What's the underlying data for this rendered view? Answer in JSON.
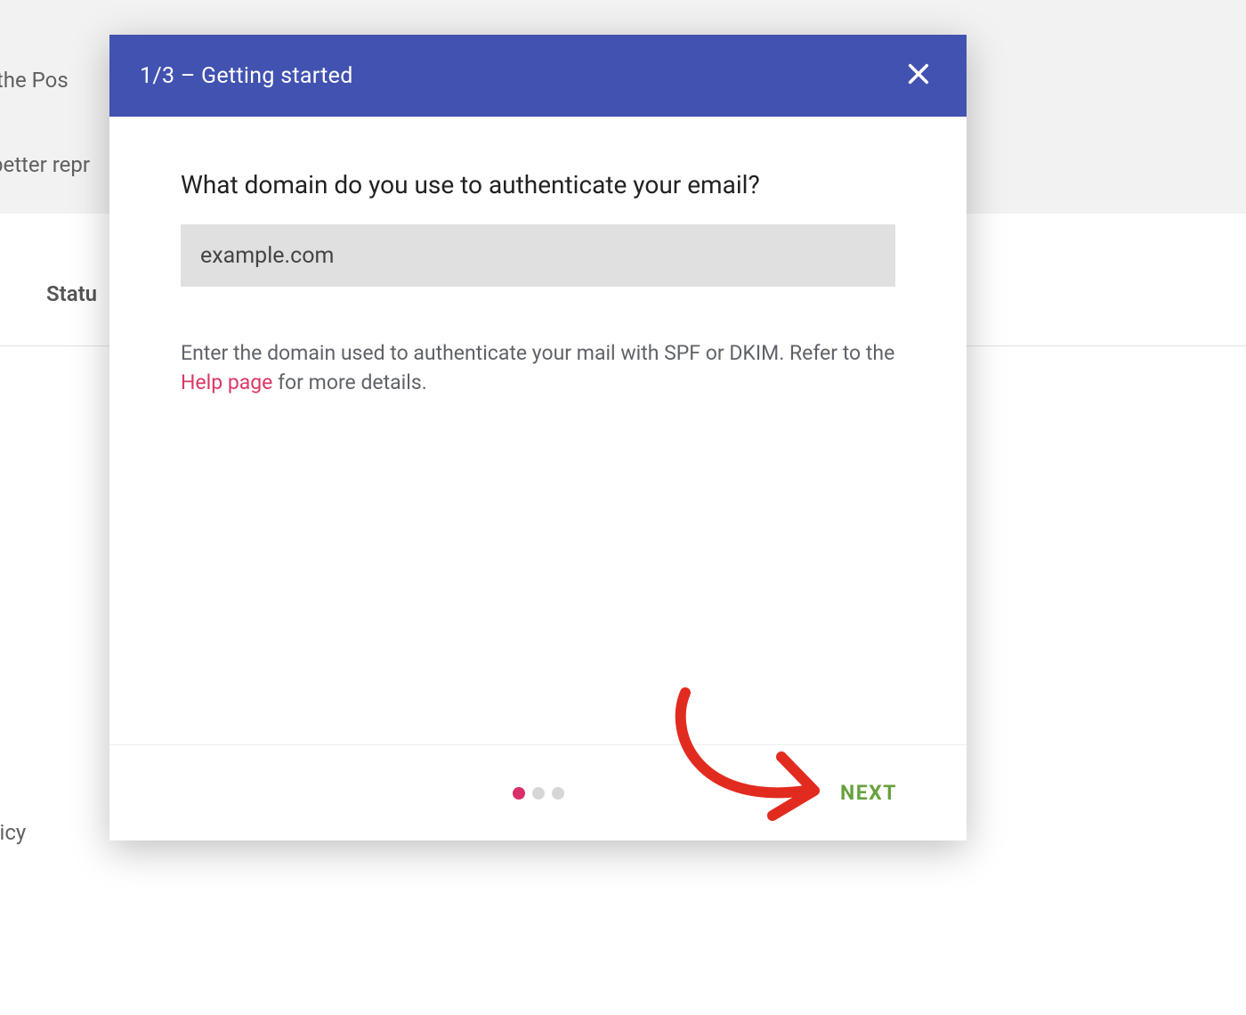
{
  "background": {
    "frag1": "with the Pos",
    "frag2": "better repr",
    "col_status": "Statu",
    "policy": " Policy"
  },
  "modal": {
    "step_label": "1/3 – Getting started",
    "question": "What domain do you use to authenticate your email?",
    "domain_placeholder": "example.com",
    "domain_value": "",
    "help_pre": "Enter the domain used to authenticate your mail with SPF or DKIM. Refer to the ",
    "help_link": "Help page",
    "help_post": " for more details.",
    "next_label": "NEXT",
    "total_steps": 3,
    "current_step": 1
  },
  "colors": {
    "header_bg": "#4252b0",
    "link": "#dc3866",
    "next": "#68a23e",
    "dot_active": "#d82e6a"
  }
}
